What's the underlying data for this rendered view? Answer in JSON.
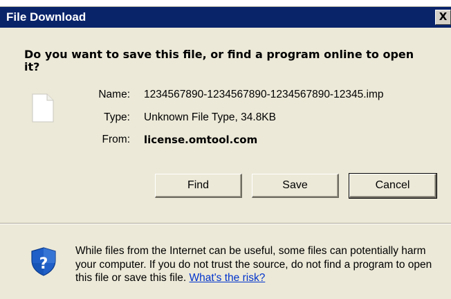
{
  "window": {
    "title": "File Download",
    "close_label": "X"
  },
  "question": "Do you want to save this file, or find a program online to open it?",
  "file_info": {
    "name_label": "Name:",
    "name_value": "1234567890-1234567890-1234567890-12345.imp",
    "type_label": "Type:",
    "type_value": "Unknown File Type, 34.8KB",
    "from_label": "From:",
    "from_value": "license.omtool.com"
  },
  "buttons": {
    "find": "Find",
    "save": "Save",
    "cancel": "Cancel"
  },
  "warning": {
    "text": "While files from the Internet can be useful, some files can potentially harm your computer. If you do not trust the source, do not find a program to open this file or save this file.",
    "link_text": "What's the risk?"
  },
  "icons": {
    "file": "blank-file-icon",
    "warning": "security-shield-question-icon"
  },
  "colors": {
    "titlebar": "#0a246a",
    "dialog_bg": "#ece9d8",
    "link": "#0033cc",
    "shield": "#1f5fc7"
  }
}
